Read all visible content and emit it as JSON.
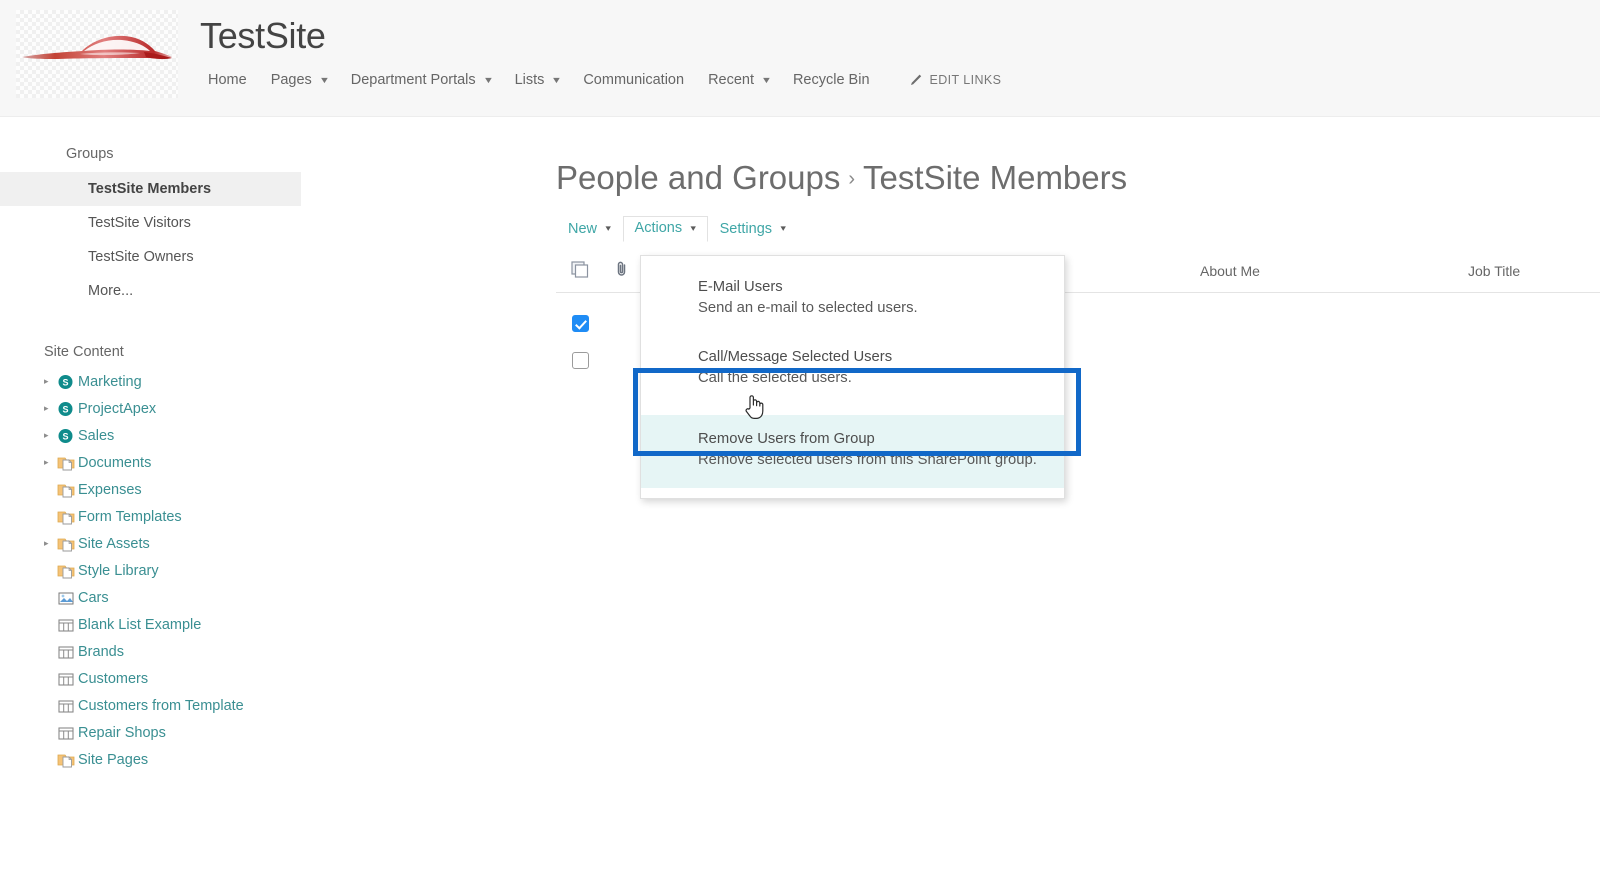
{
  "header": {
    "site_title": "TestSite",
    "logo_icon": "car-silhouette-logo",
    "nav_items": [
      {
        "label": "Home",
        "has_caret": false
      },
      {
        "label": "Pages",
        "has_caret": true
      },
      {
        "label": "Department Portals",
        "has_caret": true
      },
      {
        "label": "Lists",
        "has_caret": true
      },
      {
        "label": "Communication",
        "has_caret": false
      },
      {
        "label": "Recent",
        "has_caret": true
      },
      {
        "label": "Recycle Bin",
        "has_caret": false
      }
    ],
    "edit_links_label": "EDIT LINKS",
    "edit_links_icon": "pencil-icon"
  },
  "left_nav": {
    "groups_heading": "Groups",
    "groups": [
      {
        "label": "TestSite Members",
        "selected": true
      },
      {
        "label": "TestSite Visitors",
        "selected": false
      },
      {
        "label": "TestSite Owners",
        "selected": false
      },
      {
        "label": "More...",
        "selected": false
      }
    ],
    "site_content_heading": "Site Content",
    "tree": [
      {
        "label": "Marketing",
        "icon": "sharepoint-site-icon",
        "expandable": true
      },
      {
        "label": "ProjectApex",
        "icon": "sharepoint-site-icon",
        "expandable": true
      },
      {
        "label": "Sales",
        "icon": "sharepoint-site-icon",
        "expandable": true
      },
      {
        "label": "Documents",
        "icon": "document-library-icon",
        "expandable": true
      },
      {
        "label": "Expenses",
        "icon": "document-library-icon",
        "expandable": false
      },
      {
        "label": "Form Templates",
        "icon": "document-library-icon",
        "expandable": false
      },
      {
        "label": "Site Assets",
        "icon": "document-library-icon",
        "expandable": true
      },
      {
        "label": "Style Library",
        "icon": "document-library-icon",
        "expandable": false
      },
      {
        "label": "Cars",
        "icon": "picture-library-icon",
        "expandable": false
      },
      {
        "label": "Blank List Example",
        "icon": "list-icon",
        "expandable": false
      },
      {
        "label": "Brands",
        "icon": "list-icon",
        "expandable": false
      },
      {
        "label": "Customers",
        "icon": "list-icon",
        "expandable": false
      },
      {
        "label": "Customers from Template",
        "icon": "list-icon",
        "expandable": false
      },
      {
        "label": "Repair Shops",
        "icon": "list-icon",
        "expandable": false
      },
      {
        "label": "Site Pages",
        "icon": "document-library-icon",
        "expandable": false
      }
    ]
  },
  "main": {
    "breadcrumb_root": "People and Groups",
    "breadcrumb_separator": "›",
    "breadcrumb_current": "TestSite Members",
    "toolbar": [
      {
        "label": "New",
        "caret": "▾",
        "open": false
      },
      {
        "label": "Actions",
        "caret": "▾",
        "open": true
      },
      {
        "label": "Settings",
        "caret": "▾",
        "open": false
      }
    ],
    "table": {
      "select_all_icon": "select-all-documents-icon",
      "attachment_icon": "paperclip-icon",
      "columns": [
        "About Me",
        "Job Title"
      ],
      "rows": [
        {
          "checked": true,
          "small_checked": false
        },
        {
          "checked": false,
          "small_checked": false
        }
      ]
    }
  },
  "menu": {
    "items": [
      {
        "title": "E-Mail Users",
        "desc": "Send an e-mail to selected users.",
        "hovered": false
      },
      {
        "title": "Call/Message Selected Users",
        "desc": "Call the selected users.",
        "hovered": false
      },
      {
        "title": "Remove Users from Group",
        "desc": "Remove selected users from this SharePoint group.",
        "hovered": true
      }
    ]
  },
  "annotation": {
    "highlight_color": "#1168c8",
    "target": "Remove Users from Group"
  },
  "colors": {
    "teal_link": "#3a8f92",
    "toolbar_link": "#3fa6a6",
    "checkbox_blue": "#1f8cf5",
    "header_bg": "#f7f7f7",
    "hover_bg": "#e6f5f5"
  }
}
